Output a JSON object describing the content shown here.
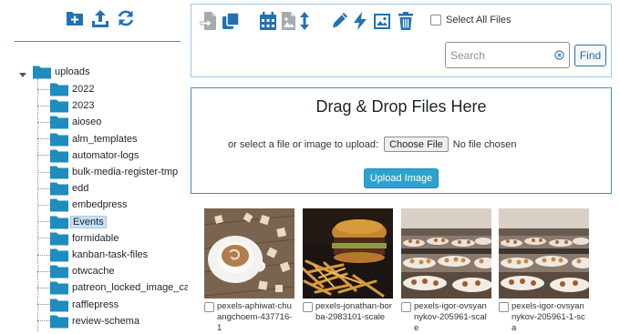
{
  "sidebar": {
    "icons": [
      "add-folder-icon",
      "upload-icon",
      "refresh-icon"
    ],
    "tree": {
      "root": {
        "label": "uploads"
      },
      "children": [
        {
          "label": "2022"
        },
        {
          "label": "2023"
        },
        {
          "label": "aioseo"
        },
        {
          "label": "alm_templates"
        },
        {
          "label": "automator-logs"
        },
        {
          "label": "bulk-media-register-tmp"
        },
        {
          "label": "edd"
        },
        {
          "label": "embedpress"
        },
        {
          "label": "Events",
          "selected": true
        },
        {
          "label": "formidable"
        },
        {
          "label": "kanban-task-files"
        },
        {
          "label": "otwcache"
        },
        {
          "label": "patreon_locked_image_cache"
        },
        {
          "label": "rafflepress"
        },
        {
          "label": "review-schema"
        }
      ]
    }
  },
  "toolbar": {
    "icons": [
      "move-icon",
      "copy-icon",
      "calendar-icon",
      "image-file-icon",
      "sort-icon",
      "edit-icon",
      "flash-icon",
      "image-icon",
      "trash-icon"
    ],
    "select_all_label": "Select All Files",
    "search_placeholder": "Search",
    "find_label": "Find"
  },
  "dropzone": {
    "title": "Drag & Drop Files Here",
    "prompt": "or select a file or image to upload:",
    "choose_label": "Choose File",
    "no_file_label": "No file chosen",
    "upload_label": "Upload Image"
  },
  "files": [
    {
      "name": "pexels-aphiwat-chuangchoem-437716-1",
      "kind": "coffee"
    },
    {
      "name": "pexels-jonathan-borba-2983101-scale",
      "kind": "burger"
    },
    {
      "name": "pexels-igor-ovsyannykov-205961-scale",
      "kind": "buffet"
    },
    {
      "name": "pexels-igor-ovsyannykov-205961-1-sca",
      "kind": "buffet"
    }
  ],
  "colors": {
    "accent": "#2271b1",
    "folder": "#1e8cbe",
    "upload_button": "#2ea2cc",
    "border": "#3a8fd6"
  }
}
